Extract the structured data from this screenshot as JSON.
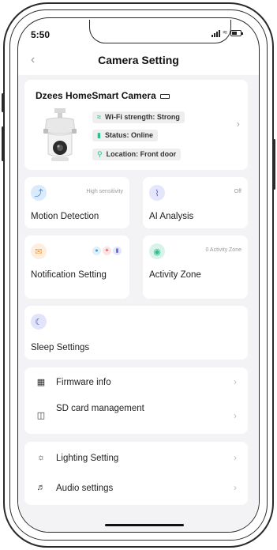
{
  "status_bar": {
    "time": "5:50"
  },
  "header": {
    "back_icon": "chevron-left-icon",
    "title": "Camera Setting"
  },
  "camera": {
    "name": "Dzees HomeSmart Camera",
    "wifi": "Wi-Fi strength: Strong",
    "status": "Status: Online",
    "location": "Location: Front door"
  },
  "tiles": {
    "motion": {
      "meta": "High sensitivity",
      "label": "Motion Detection"
    },
    "ai": {
      "meta": "Off",
      "label": "AI Analysis"
    },
    "notification": {
      "label": "Notification Setting"
    },
    "activity": {
      "meta": "0 Activity Zone",
      "label": "Activity Zone"
    },
    "sleep": {
      "label": "Sleep Settings"
    }
  },
  "list_system": [
    {
      "label": "Firmware info",
      "icon": "chip-icon"
    },
    {
      "label": "SD card management",
      "icon": "sd-card-icon"
    }
  ],
  "list_media": [
    {
      "label": "Lighting Setting",
      "icon": "bulb-icon"
    },
    {
      "label": "Audio settings",
      "icon": "speaker-icon"
    }
  ],
  "colors": {
    "motion_icon_bg": "#dcebfb",
    "ai_icon_bg": "#e4e6fb",
    "notification_icon_bg": "#fdeedd",
    "activity_icon_bg": "#daf3ea",
    "sleep_icon_bg": "#e2e4fa",
    "online_green": "#2fbf8f"
  }
}
